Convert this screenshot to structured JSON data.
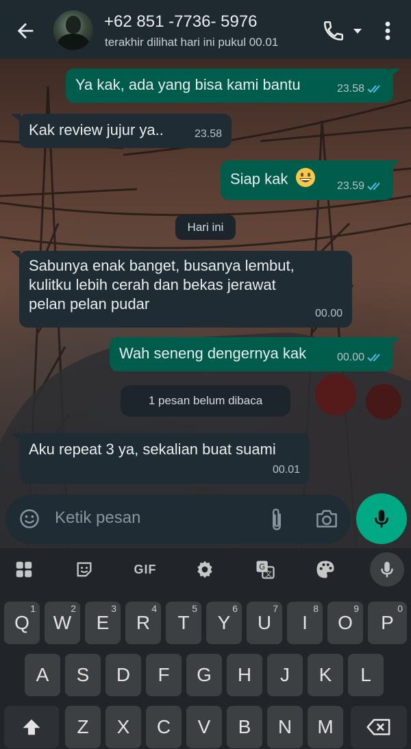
{
  "header": {
    "contact_name": "+62 851 -7736- 5976",
    "last_seen": "terakhir dilihat hari ini pukul 00.01",
    "icons": [
      "back-arrow-icon",
      "avatar",
      "phone-icon",
      "caret-down-icon",
      "more-vert-icon"
    ]
  },
  "messages": [
    {
      "dir": "out",
      "text": "Ya kak, ada yang bisa kami bantu",
      "time": "23.58",
      "read": true
    },
    {
      "dir": "in",
      "text": "Kak review jujur ya..",
      "time": "23.58"
    },
    {
      "dir": "out",
      "text": "Siap kak",
      "emoji": "grinning-face",
      "time": "23.59",
      "read": true
    },
    {
      "dir": "in",
      "text": "Sabunya enak banget, busanya lembut, kulitku lebih cerah dan bekas jerawat pelan pelan pudar",
      "lines": [
        "Sabunya enak banget, busanya lembut,",
        "kulitku lebih cerah dan bekas jerawat",
        "pelan pelan pudar"
      ],
      "time": "00.00"
    },
    {
      "dir": "out",
      "text": "Wah seneng dengernya kak",
      "time": "00.00",
      "read": true
    },
    {
      "dir": "in",
      "text": "Aku repeat 3 ya, sekalian buat suami",
      "time": "00.01"
    }
  ],
  "date_divider": "Hari ini",
  "unread_divider": "1 pesan belum dibaca",
  "composer": {
    "placeholder": "Ketik pesan",
    "icons": [
      "emoji-icon",
      "attach-icon",
      "camera-icon",
      "mic-icon"
    ]
  },
  "keyboard": {
    "toolbar": {
      "gif_label": "GIF",
      "icons": [
        "apps-grid-icon",
        "sticker-icon",
        "gif-icon",
        "settings-gear-icon",
        "translate-icon",
        "palette-icon",
        "mic-icon"
      ]
    },
    "row1": [
      {
        "label": "Q",
        "hint": "1"
      },
      {
        "label": "W",
        "hint": "2"
      },
      {
        "label": "E",
        "hint": "3"
      },
      {
        "label": "R",
        "hint": "4"
      },
      {
        "label": "T",
        "hint": "5"
      },
      {
        "label": "Y",
        "hint": "6"
      },
      {
        "label": "U",
        "hint": "7"
      },
      {
        "label": "I",
        "hint": "8"
      },
      {
        "label": "O",
        "hint": "9"
      },
      {
        "label": "P",
        "hint": "0"
      }
    ],
    "row2": [
      "A",
      "S",
      "D",
      "F",
      "G",
      "H",
      "J",
      "K",
      "L"
    ],
    "row3": [
      "Z",
      "X",
      "C",
      "V",
      "B",
      "N",
      "M"
    ]
  },
  "colors": {
    "outgoing_bubble": "#005c4b",
    "incoming_bubble": "#1f2c34",
    "header_bg": "#1f2a30",
    "read_ticks": "#53bdeb",
    "mic_button": "#00a884",
    "keyboard_bg": "#212428"
  }
}
